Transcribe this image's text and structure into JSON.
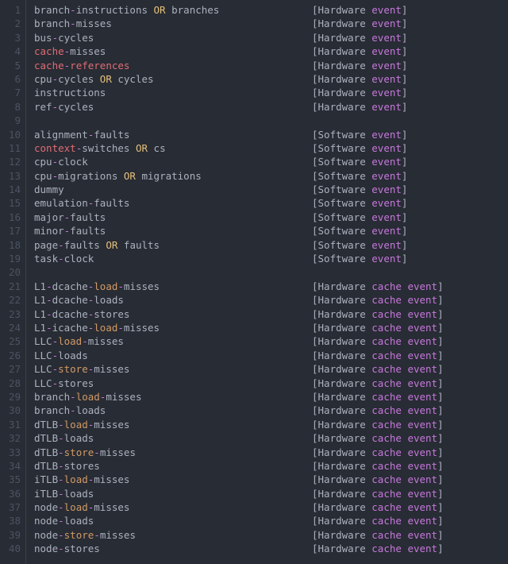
{
  "colors": {
    "background": "#282c34",
    "foreground": "#abb2bf",
    "gutter": "#4b5363",
    "keyword": "#c678dd",
    "redish": "#e06c75",
    "yellow": "#e5c07b",
    "orange": "#d19a66"
  },
  "words": {
    "OR": "OR"
  },
  "categories": {
    "hw": {
      "a": "[Hardware ",
      "b": "event",
      "c": "]"
    },
    "sw": {
      "a": "[Software ",
      "b": "event",
      "c": "]"
    },
    "cache": {
      "a": "[Hardware ",
      "b": "cache",
      "c": " ",
      "d": "event",
      "e": "]"
    }
  },
  "lines": [
    {
      "num": 1,
      "cat": "hw",
      "tokens": [
        [
          "dim",
          "branch"
        ],
        [
          "pur",
          "-"
        ],
        [
          "dim",
          "instructions"
        ],
        [
          "dim",
          " "
        ],
        [
          "yel",
          "OR"
        ],
        [
          "dim",
          " branches"
        ]
      ]
    },
    {
      "num": 2,
      "cat": "hw",
      "tokens": [
        [
          "dim",
          "branch"
        ],
        [
          "pur",
          "-"
        ],
        [
          "dim",
          "misses"
        ]
      ]
    },
    {
      "num": 3,
      "cat": "hw",
      "tokens": [
        [
          "dim",
          "bus"
        ],
        [
          "pur",
          "-"
        ],
        [
          "dim",
          "cycles"
        ]
      ]
    },
    {
      "num": 4,
      "cat": "hw",
      "tokens": [
        [
          "red",
          "cache"
        ],
        [
          "pur",
          "-"
        ],
        [
          "dim",
          "misses"
        ]
      ]
    },
    {
      "num": 5,
      "cat": "hw",
      "tokens": [
        [
          "red",
          "cache"
        ],
        [
          "pur",
          "-"
        ],
        [
          "red",
          "references"
        ]
      ]
    },
    {
      "num": 6,
      "cat": "hw",
      "tokens": [
        [
          "dim",
          "cpu"
        ],
        [
          "pur",
          "-"
        ],
        [
          "dim",
          "cycles"
        ],
        [
          "dim",
          " "
        ],
        [
          "yel",
          "OR"
        ],
        [
          "dim",
          " cycles"
        ]
      ]
    },
    {
      "num": 7,
      "cat": "hw",
      "tokens": [
        [
          "dim",
          "instructions"
        ]
      ]
    },
    {
      "num": 8,
      "cat": "hw",
      "tokens": [
        [
          "dim",
          "ref"
        ],
        [
          "pur",
          "-"
        ],
        [
          "dim",
          "cycles"
        ]
      ]
    },
    {
      "num": 9,
      "cat": null,
      "tokens": []
    },
    {
      "num": 10,
      "cat": "sw",
      "tokens": [
        [
          "dim",
          "alignment"
        ],
        [
          "pur",
          "-"
        ],
        [
          "dim",
          "faults"
        ]
      ]
    },
    {
      "num": 11,
      "cat": "sw",
      "tokens": [
        [
          "red",
          "context"
        ],
        [
          "pur",
          "-"
        ],
        [
          "dim",
          "switches"
        ],
        [
          "dim",
          " "
        ],
        [
          "yel",
          "OR"
        ],
        [
          "dim",
          " cs"
        ]
      ]
    },
    {
      "num": 12,
      "cat": "sw",
      "tokens": [
        [
          "dim",
          "cpu"
        ],
        [
          "pur",
          "-"
        ],
        [
          "dim",
          "clock"
        ]
      ]
    },
    {
      "num": 13,
      "cat": "sw",
      "tokens": [
        [
          "dim",
          "cpu"
        ],
        [
          "pur",
          "-"
        ],
        [
          "dim",
          "migrations"
        ],
        [
          "dim",
          " "
        ],
        [
          "yel",
          "OR"
        ],
        [
          "dim",
          " migrations"
        ]
      ]
    },
    {
      "num": 14,
      "cat": "sw",
      "tokens": [
        [
          "dim",
          "dummy"
        ]
      ]
    },
    {
      "num": 15,
      "cat": "sw",
      "tokens": [
        [
          "dim",
          "emulation"
        ],
        [
          "pur",
          "-"
        ],
        [
          "dim",
          "faults"
        ]
      ]
    },
    {
      "num": 16,
      "cat": "sw",
      "tokens": [
        [
          "dim",
          "major"
        ],
        [
          "pur",
          "-"
        ],
        [
          "dim",
          "faults"
        ]
      ]
    },
    {
      "num": 17,
      "cat": "sw",
      "tokens": [
        [
          "dim",
          "minor"
        ],
        [
          "pur",
          "-"
        ],
        [
          "dim",
          "faults"
        ]
      ]
    },
    {
      "num": 18,
      "cat": "sw",
      "tokens": [
        [
          "dim",
          "page"
        ],
        [
          "pur",
          "-"
        ],
        [
          "dim",
          "faults"
        ],
        [
          "dim",
          " "
        ],
        [
          "yel",
          "OR"
        ],
        [
          "dim",
          " faults"
        ]
      ]
    },
    {
      "num": 19,
      "cat": "sw",
      "tokens": [
        [
          "dim",
          "task"
        ],
        [
          "pur",
          "-"
        ],
        [
          "dim",
          "clock"
        ]
      ]
    },
    {
      "num": 20,
      "cat": null,
      "tokens": []
    },
    {
      "num": 21,
      "cat": "cache",
      "tokens": [
        [
          "dim",
          "L1"
        ],
        [
          "pur",
          "-"
        ],
        [
          "dim",
          "dcache"
        ],
        [
          "pur",
          "-"
        ],
        [
          "yel2",
          "load"
        ],
        [
          "pur",
          "-"
        ],
        [
          "dim",
          "misses"
        ]
      ]
    },
    {
      "num": 22,
      "cat": "cache",
      "tokens": [
        [
          "dim",
          "L1"
        ],
        [
          "pur",
          "-"
        ],
        [
          "dim",
          "dcache"
        ],
        [
          "pur",
          "-"
        ],
        [
          "dim",
          "loads"
        ]
      ]
    },
    {
      "num": 23,
      "cat": "cache",
      "tokens": [
        [
          "dim",
          "L1"
        ],
        [
          "pur",
          "-"
        ],
        [
          "dim",
          "dcache"
        ],
        [
          "pur",
          "-"
        ],
        [
          "dim",
          "stores"
        ]
      ]
    },
    {
      "num": 24,
      "cat": "cache",
      "tokens": [
        [
          "dim",
          "L1"
        ],
        [
          "pur",
          "-"
        ],
        [
          "dim",
          "icache"
        ],
        [
          "pur",
          "-"
        ],
        [
          "yel2",
          "load"
        ],
        [
          "pur",
          "-"
        ],
        [
          "dim",
          "misses"
        ]
      ]
    },
    {
      "num": 25,
      "cat": "cache",
      "tokens": [
        [
          "dim",
          "LLC"
        ],
        [
          "pur",
          "-"
        ],
        [
          "yel2",
          "load"
        ],
        [
          "pur",
          "-"
        ],
        [
          "dim",
          "misses"
        ]
      ]
    },
    {
      "num": 26,
      "cat": "cache",
      "tokens": [
        [
          "dim",
          "LLC"
        ],
        [
          "pur",
          "-"
        ],
        [
          "dim",
          "loads"
        ]
      ]
    },
    {
      "num": 27,
      "cat": "cache",
      "tokens": [
        [
          "dim",
          "LLC"
        ],
        [
          "pur",
          "-"
        ],
        [
          "yel2",
          "store"
        ],
        [
          "pur",
          "-"
        ],
        [
          "dim",
          "misses"
        ]
      ]
    },
    {
      "num": 28,
      "cat": "cache",
      "tokens": [
        [
          "dim",
          "LLC"
        ],
        [
          "pur",
          "-"
        ],
        [
          "dim",
          "stores"
        ]
      ]
    },
    {
      "num": 29,
      "cat": "cache",
      "tokens": [
        [
          "dim",
          "branch"
        ],
        [
          "pur",
          "-"
        ],
        [
          "yel2",
          "load"
        ],
        [
          "pur",
          "-"
        ],
        [
          "dim",
          "misses"
        ]
      ]
    },
    {
      "num": 30,
      "cat": "cache",
      "tokens": [
        [
          "dim",
          "branch"
        ],
        [
          "pur",
          "-"
        ],
        [
          "dim",
          "loads"
        ]
      ]
    },
    {
      "num": 31,
      "cat": "cache",
      "tokens": [
        [
          "dim",
          "dTLB"
        ],
        [
          "pur",
          "-"
        ],
        [
          "yel2",
          "load"
        ],
        [
          "pur",
          "-"
        ],
        [
          "dim",
          "misses"
        ]
      ]
    },
    {
      "num": 32,
      "cat": "cache",
      "tokens": [
        [
          "dim",
          "dTLB"
        ],
        [
          "pur",
          "-"
        ],
        [
          "dim",
          "loads"
        ]
      ]
    },
    {
      "num": 33,
      "cat": "cache",
      "tokens": [
        [
          "dim",
          "dTLB"
        ],
        [
          "pur",
          "-"
        ],
        [
          "yel2",
          "store"
        ],
        [
          "pur",
          "-"
        ],
        [
          "dim",
          "misses"
        ]
      ]
    },
    {
      "num": 34,
      "cat": "cache",
      "tokens": [
        [
          "dim",
          "dTLB"
        ],
        [
          "pur",
          "-"
        ],
        [
          "dim",
          "stores"
        ]
      ]
    },
    {
      "num": 35,
      "cat": "cache",
      "tokens": [
        [
          "dim",
          "iTLB"
        ],
        [
          "pur",
          "-"
        ],
        [
          "yel2",
          "load"
        ],
        [
          "pur",
          "-"
        ],
        [
          "dim",
          "misses"
        ]
      ]
    },
    {
      "num": 36,
      "cat": "cache",
      "tokens": [
        [
          "dim",
          "iTLB"
        ],
        [
          "pur",
          "-"
        ],
        [
          "dim",
          "loads"
        ]
      ]
    },
    {
      "num": 37,
      "cat": "cache",
      "tokens": [
        [
          "dim",
          "node"
        ],
        [
          "pur",
          "-"
        ],
        [
          "yel2",
          "load"
        ],
        [
          "pur",
          "-"
        ],
        [
          "dim",
          "misses"
        ]
      ]
    },
    {
      "num": 38,
      "cat": "cache",
      "tokens": [
        [
          "dim",
          "node"
        ],
        [
          "pur",
          "-"
        ],
        [
          "dim",
          "loads"
        ]
      ]
    },
    {
      "num": 39,
      "cat": "cache",
      "tokens": [
        [
          "dim",
          "node"
        ],
        [
          "pur",
          "-"
        ],
        [
          "yel2",
          "store"
        ],
        [
          "pur",
          "-"
        ],
        [
          "dim",
          "misses"
        ]
      ]
    },
    {
      "num": 40,
      "cat": "cache",
      "tokens": [
        [
          "dim",
          "node"
        ],
        [
          "pur",
          "-"
        ],
        [
          "dim",
          "stores"
        ]
      ]
    }
  ]
}
